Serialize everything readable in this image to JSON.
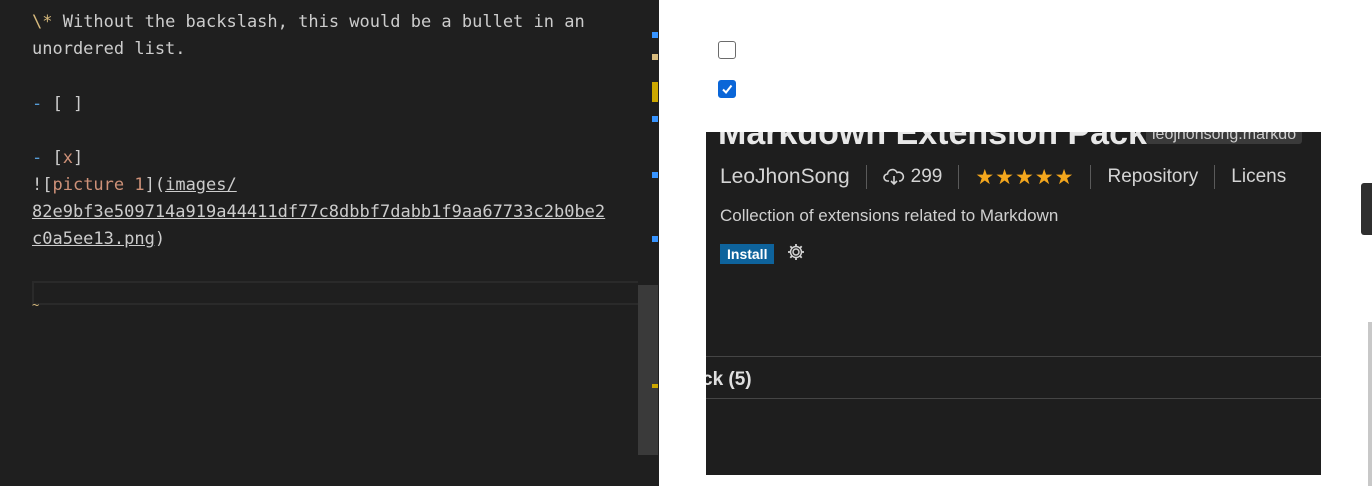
{
  "editor": {
    "line1_punc": "\\*",
    "line1_text": " Without the backslash, this would be a bullet in an",
    "line2_text": "unordered list.",
    "task1_dash": "-",
    "task1_box": "[ ]",
    "task2_dash": "-",
    "task2_open": "[",
    "task2_x": "x",
    "task2_close": "]",
    "img_bang": "![",
    "img_alt": "picture 1",
    "img_mid": "](",
    "img_path1": "images/",
    "img_path2": "82e9bf3e509714a919a44411df77c8dbbf7dabb1f9aa67733c2b0be2",
    "img_path3": "c0a5ee13.png",
    "img_close": ")",
    "squiggle": "~"
  },
  "preview": {
    "ext_title": "Markdown Extension Pack",
    "ext_id": "leojhonsong.markdo",
    "publisher": "LeoJhonSong",
    "installs": "299",
    "stars": "★★★★★",
    "repository": "Repository",
    "license": "Licens",
    "description": "Collection of extensions related to Markdown",
    "install_label": "Install",
    "pack_label": "ck (5)"
  },
  "colors": {
    "checkbox_checked": "#0a66d8",
    "install_button": "#0e639c",
    "stars": "#f4a71d"
  }
}
